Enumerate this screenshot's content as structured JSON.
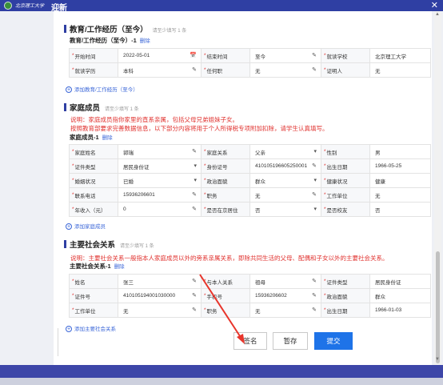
{
  "header": {
    "school": "北京理工大学",
    "title": "迎新",
    "close_icon": "close-icon"
  },
  "edu": {
    "title": "教育/工作经历（至今）",
    "hint": "请至少填写 1 条",
    "sub": "教育/工作经历（至今）-1",
    "delete": "删除",
    "rows": [
      [
        {
          "label": "开始时间",
          "value": "2022-05-01",
          "icon": "📅"
        },
        {
          "label": "结束时间",
          "value": "至今",
          "icon": "✎"
        },
        {
          "label": "就读学校",
          "value": "北京理工大学",
          "icon": ""
        }
      ],
      [
        {
          "label": "就读学历",
          "value": "本科",
          "icon": "✎"
        },
        {
          "label": "任何职",
          "value": "无",
          "icon": "✎"
        },
        {
          "label": "证明人",
          "value": "无",
          "icon": ""
        }
      ]
    ],
    "add": "添加教育/工作经历（至今）"
  },
  "family": {
    "title": "家庭成员",
    "hint": "请至少填写 1 条",
    "note1": "说明：家庭成员指你家里的直系亲属，包括父母兄弟姐妹子女。",
    "note2": "按照教育部要求完善数据信息，以下部分内容将用于个人所得税专项附加扣除，请学生认真填写。",
    "sub": "家庭成员-1",
    "delete": "删除",
    "rows": [
      [
        {
          "label": "家庭姓名",
          "value": "郭瑞",
          "icon": "✎"
        },
        {
          "label": "家庭关系",
          "value": "父亲",
          "icon": "▾"
        },
        {
          "label": "性别",
          "value": "男",
          "icon": ""
        }
      ],
      [
        {
          "label": "证件类型",
          "value": "居民身份证",
          "icon": "▾"
        },
        {
          "label": "身份证号",
          "value": "410105196605250001",
          "icon": "✎"
        },
        {
          "label": "出生日期",
          "value": "1966-05-25",
          "icon": ""
        }
      ],
      [
        {
          "label": "婚姻状况",
          "value": "已婚",
          "icon": "▾"
        },
        {
          "label": "政治面貌",
          "value": "群众",
          "icon": "▾"
        },
        {
          "label": "健康状况",
          "value": "健康",
          "icon": ""
        }
      ],
      [
        {
          "label": "联系电话",
          "value": "15936206601",
          "icon": "✎"
        },
        {
          "label": "职务",
          "value": "无",
          "icon": "✎"
        },
        {
          "label": "工作单位",
          "value": "无",
          "icon": ""
        }
      ],
      [
        {
          "label": "年收入（元）",
          "value": "0",
          "icon": "✎"
        },
        {
          "label": "是否在京居住",
          "value": "否",
          "icon": "▾"
        },
        {
          "label": "是否校友",
          "value": "否",
          "icon": ""
        }
      ]
    ],
    "add": "添加家庭成员"
  },
  "social": {
    "title": "主要社会关系",
    "hint": "请至少填写 1 条",
    "note": "说明：主要社会关系一般指本人家庭成员以外的旁系亲属关系，即除共同生活的父母、配偶和子女以外的主要社会关系。",
    "sub": "主要社会关系-1",
    "delete": "删除",
    "rows": [
      [
        {
          "label": "姓名",
          "value": "张三",
          "icon": "✎"
        },
        {
          "label": "与本人关系",
          "value": "祖母",
          "icon": "✎"
        },
        {
          "label": "证件类型",
          "value": "居民身份证",
          "icon": ""
        }
      ],
      [
        {
          "label": "证件号",
          "value": "410105194001030000",
          "icon": "✎"
        },
        {
          "label": "手机号",
          "value": "15936206602",
          "icon": "✎"
        },
        {
          "label": "政治面貌",
          "value": "群众",
          "icon": ""
        }
      ],
      [
        {
          "label": "工作单位",
          "value": "无",
          "icon": "✎"
        },
        {
          "label": "职务",
          "value": "无",
          "icon": "✎"
        },
        {
          "label": "出生日期",
          "value": "1966-01-03",
          "icon": ""
        }
      ]
    ],
    "add": "添加主要社会关系"
  },
  "buttons": {
    "sign": "签名",
    "save": "暂存",
    "submit": "提交"
  },
  "colors": {
    "primary": "#1e73e8",
    "header": "#2f3fa3",
    "note": "#e0312e"
  }
}
